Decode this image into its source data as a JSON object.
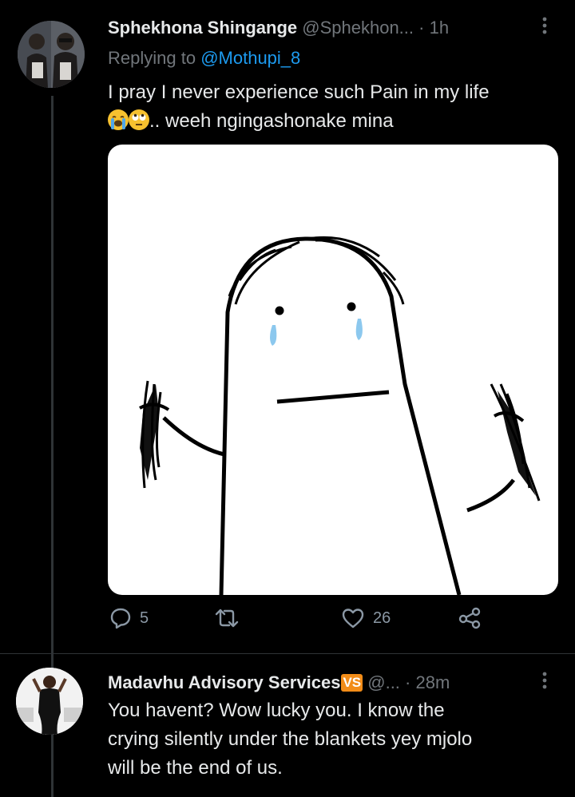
{
  "tweet1": {
    "display_name": "Sphekhona Shingange",
    "handle": "@Sphekhon...",
    "separator": "·",
    "time": "1h",
    "replying_label": "Replying to",
    "replying_to": "@Mothupi_8",
    "text_line1": "I pray I never experience such Pain in my life",
    "text_line2": ".. weeh ngingashonake mina",
    "emojis": [
      "loudly-crying-face",
      "face-with-rolling-eyes"
    ],
    "media_description_icon": "crying-stick-figure-meme",
    "actions": {
      "reply_count": "5",
      "retweet_count": "",
      "like_count": "26"
    }
  },
  "tweet2": {
    "display_name": "Madavhu Advisory Services",
    "badge": "VS",
    "handle": "@...",
    "separator": "·",
    "time": "28m",
    "text_lines": [
      "You havent? Wow lucky you. I know the",
      "crying silently under the blankets yey mjolo",
      "will be the end of us."
    ]
  },
  "colors": {
    "background": "#000000",
    "text": "#e7e9ea",
    "muted": "#71767b",
    "link": "#1d9bf0",
    "badge": "#f28c18"
  }
}
